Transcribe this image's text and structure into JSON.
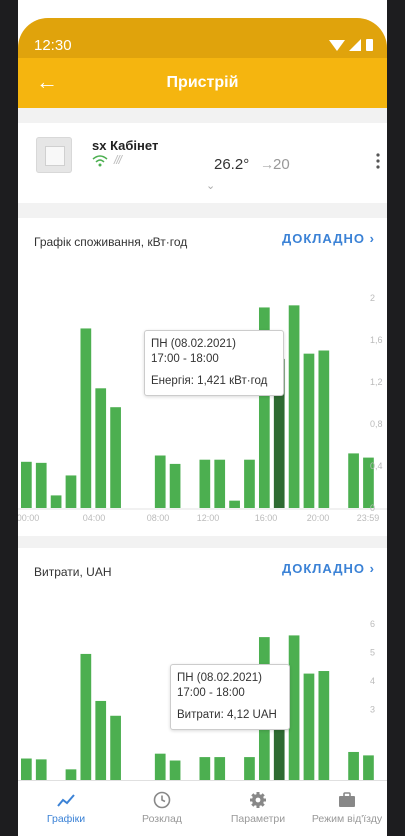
{
  "status": {
    "time": "12:30"
  },
  "appbar": {
    "title": "Пристрій"
  },
  "device": {
    "name": "sx Кабінет",
    "heating_glyph": "ℒ",
    "current_temp": "26.2°",
    "arrow": "→",
    "target_temp": "20"
  },
  "consumption": {
    "title": "Графік споживання, кВт·год",
    "more_label": "ДОКЛАДНО",
    "tooltip": {
      "day": "ПН (08.02.2021)",
      "time": "17:00 - 18:00",
      "value": "Енергія: 1,421 кВт·год"
    }
  },
  "cost": {
    "title": "Витрати, UAH",
    "more_label": "ДОКЛАДНО",
    "tooltip": {
      "day": "ПН (08.02.2021)",
      "time": "17:00 - 18:00",
      "value": "Витрати: 4,12 UAH"
    }
  },
  "nav": [
    {
      "label": "Графіки",
      "icon": "chart-icon",
      "active": true
    },
    {
      "label": "Розклад",
      "icon": "clock-icon",
      "active": false
    },
    {
      "label": "Параметри",
      "icon": "gear-icon",
      "active": false
    },
    {
      "label": "Режим від'їзду",
      "icon": "briefcase-icon",
      "active": false
    }
  ],
  "colors": {
    "accent": "#f5b50f",
    "bar": "#4caf50",
    "bar_selected": "#2e6b32",
    "link": "#3b82d6"
  },
  "chart_data": [
    {
      "type": "bar",
      "title": "Графік споживання, кВт·год",
      "categories": [
        "00:00",
        "01:00",
        "02:00",
        "03:00",
        "04:00",
        "05:00",
        "06:00",
        "07:00",
        "08:00",
        "09:00",
        "10:00",
        "11:00",
        "12:00",
        "13:00",
        "14:00",
        "15:00",
        "16:00",
        "17:00",
        "18:00",
        "19:00",
        "20:00",
        "21:00",
        "22:00",
        "23:00"
      ],
      "values": [
        0.44,
        0.43,
        0.12,
        0.31,
        1.71,
        1.14,
        0.96,
        0,
        0,
        0.5,
        0.42,
        0,
        0.46,
        0.46,
        0.07,
        0.46,
        1.91,
        1.42,
        1.93,
        1.47,
        1.5,
        0,
        0.52,
        0.48
      ],
      "selected_index": 17,
      "x_tick_labels": [
        "00:00",
        "04:00",
        "08:00",
        "12:00",
        "16:00",
        "20:00",
        "23:59"
      ],
      "y_tick_labels": [
        "0",
        "0,4",
        "0,8",
        "1,2",
        "1,6",
        "2"
      ],
      "ylim": [
        0,
        2
      ]
    },
    {
      "type": "bar",
      "title": "Витрати, UAH",
      "categories": [
        "00:00",
        "01:00",
        "02:00",
        "03:00",
        "04:00",
        "05:00",
        "06:00",
        "07:00",
        "08:00",
        "09:00",
        "10:00",
        "11:00",
        "12:00",
        "13:00",
        "14:00",
        "15:00",
        "16:00",
        "17:00",
        "18:00",
        "19:00",
        "20:00",
        "21:00",
        "22:00",
        "23:00"
      ],
      "values": [
        1.28,
        1.25,
        0.35,
        0.9,
        4.95,
        3.3,
        2.78,
        0,
        0,
        1.45,
        1.21,
        0,
        1.33,
        1.33,
        0.2,
        1.33,
        5.54,
        4.12,
        5.6,
        4.26,
        4.35,
        0,
        1.51,
        1.39
      ],
      "selected_index": 17,
      "y_tick_labels": [
        "3",
        "4",
        "5",
        "6"
      ],
      "ylim": [
        0,
        6
      ]
    }
  ]
}
